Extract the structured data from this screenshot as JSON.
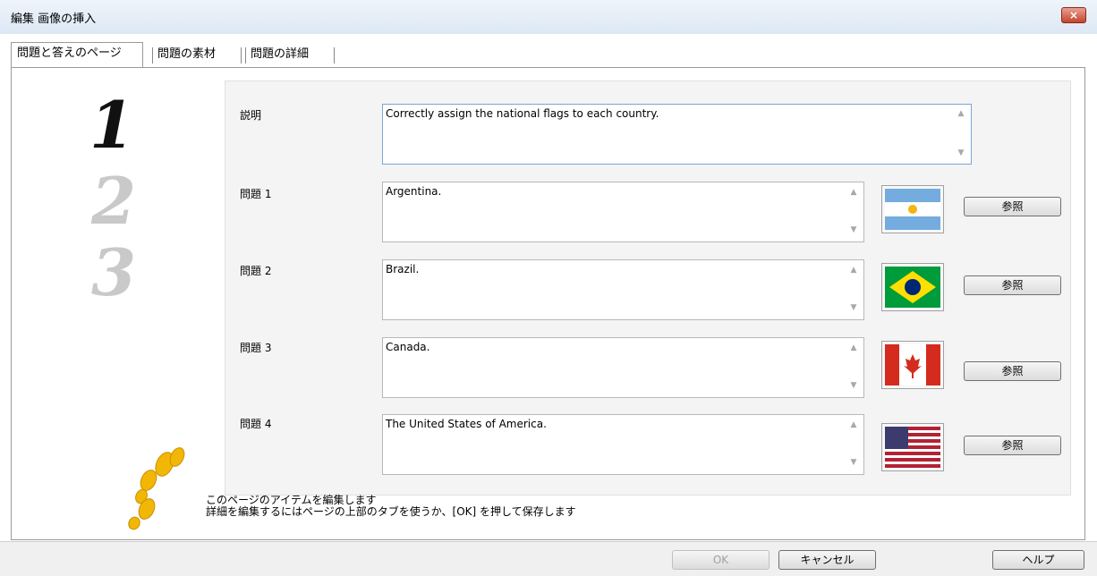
{
  "window": {
    "title": "編集 画像の挿入",
    "close_label": "×"
  },
  "tabs": [
    {
      "label": "問題と答えのページ"
    },
    {
      "label": "問題の素材"
    },
    {
      "label": "問題の詳細"
    }
  ],
  "description": {
    "label": "説明",
    "value": "Correctly assign the national flags to each country."
  },
  "questions": [
    {
      "label": "問題 1",
      "value": "Argentina.",
      "flag_icon": "argentina-flag",
      "browse_label": "参照"
    },
    {
      "label": "問題 2",
      "value": "Brazil.",
      "flag_icon": "brazil-flag",
      "browse_label": "参照"
    },
    {
      "label": "問題 3",
      "value": "Canada.",
      "flag_icon": "canada-flag",
      "browse_label": "参照"
    },
    {
      "label": "問題 4",
      "value": "The United States of America.",
      "flag_icon": "usa-flag",
      "browse_label": "参照"
    }
  ],
  "side_panel": {
    "step_numbers": [
      "1",
      "2",
      "3"
    ],
    "icon": "footprints-icon"
  },
  "hint": {
    "line1": "このページのアイテムを編集します",
    "line2": "詳細を編集するにはページの上部のタブを使うか、[OK] を押して保存します"
  },
  "footer": {
    "ok_label": "OK",
    "cancel_label": "キャンセル",
    "help_label": "ヘルプ"
  },
  "colors": {
    "accent": "#7aa5d6",
    "close": "#c4452f",
    "footprint": "#f2b705"
  }
}
